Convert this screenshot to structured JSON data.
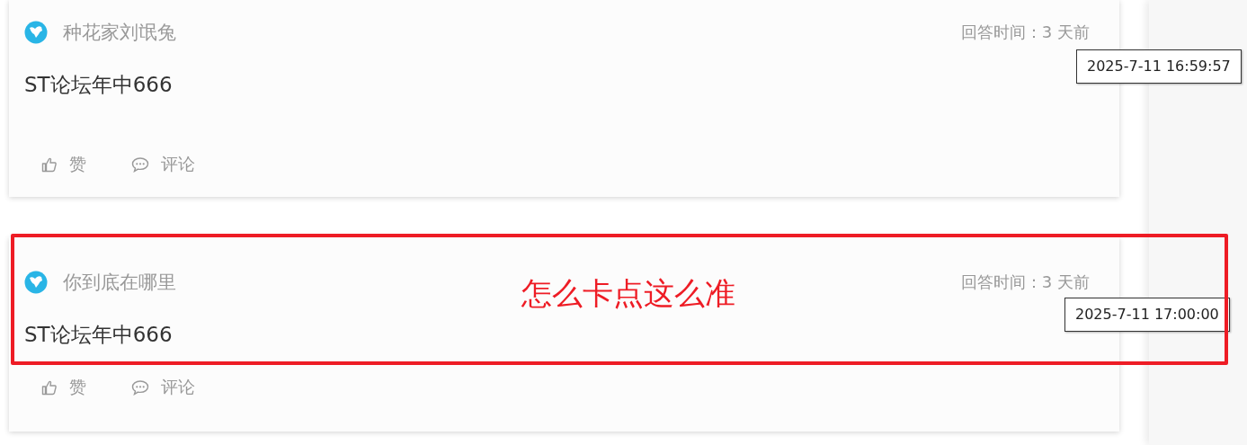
{
  "answers": [
    {
      "author": "种花家刘氓兔",
      "answer_time": "回答时间：3 天前",
      "tooltip": "2025-7-11 16:59:57",
      "content": "ST论坛年中666",
      "actions": [
        {
          "kind": "like",
          "label": "赞"
        },
        {
          "kind": "comment",
          "label": "评论"
        }
      ]
    },
    {
      "author": "你到底在哪里",
      "answer_time": "回答时间：3 天前",
      "tooltip": "2025-7-11 17:00:00",
      "content": "ST论坛年中666",
      "actions": [
        {
          "kind": "like",
          "label": "赞"
        },
        {
          "kind": "comment",
          "label": "评论"
        }
      ]
    }
  ],
  "annotation": {
    "text": "怎么卡点这么准"
  }
}
